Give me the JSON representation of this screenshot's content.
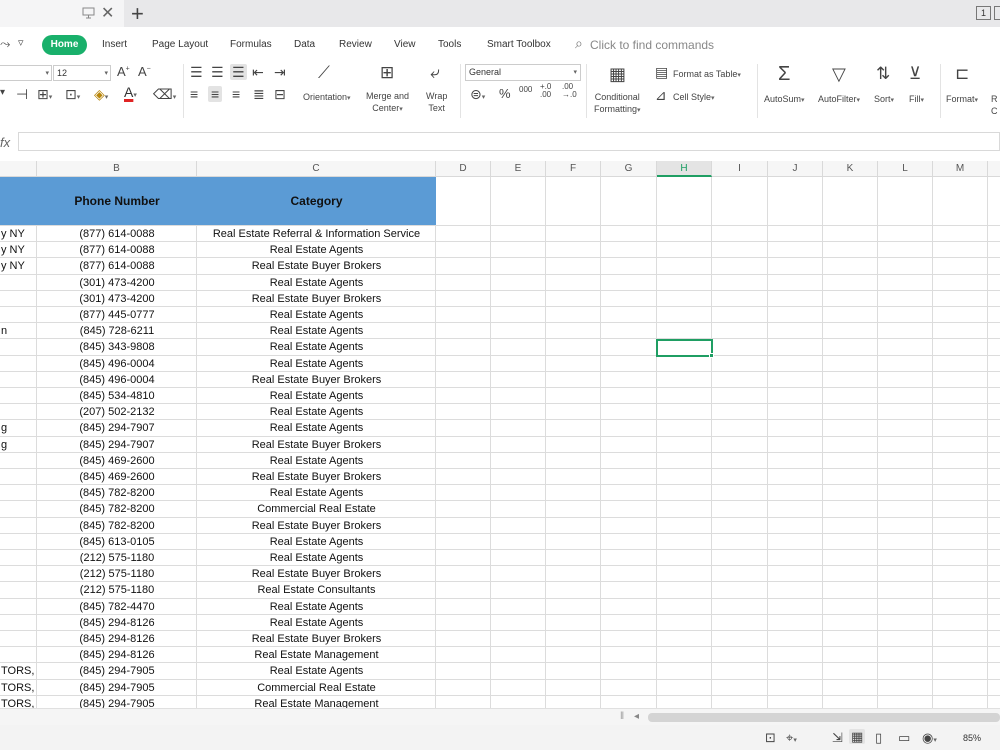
{
  "titlebar": {
    "window_number": "1"
  },
  "menu": {
    "items": [
      "Home",
      "Insert",
      "Page Layout",
      "Formulas",
      "Data",
      "Review",
      "View",
      "Tools",
      "Smart Toolbox"
    ],
    "search_placeholder": "Click to find commands",
    "accent_color": "#19b06b"
  },
  "ribbon": {
    "font_size": "12",
    "number_format": "General",
    "orientation": "Orientation",
    "merge_center": [
      "Merge and",
      "Center"
    ],
    "wrap_text": [
      "Wrap",
      "Text"
    ],
    "conditional_formatting": [
      "Conditional",
      "Formatting"
    ],
    "format_as_table": "Format as Table",
    "cell_style": "Cell Style",
    "autosum": "AutoSum",
    "autofilter": "AutoFilter",
    "sort": "Sort",
    "fill": "Fill",
    "format": "Format",
    "cut_label": "R",
    "cut_label2": "C",
    "percent": "%",
    "thousands": "000",
    "dec_inc": "+.0\n.00",
    "dec_dec": ".00\n→.0"
  },
  "formula_bar": {
    "fx": "fx",
    "value": ""
  },
  "sheet": {
    "columns": [
      "B",
      "C",
      "D",
      "E",
      "F",
      "G",
      "H",
      "I",
      "J",
      "K",
      "L",
      "M"
    ],
    "selected_column": "H",
    "header_fill": "#5b9bd5",
    "headers": {
      "phone": "Phone Number",
      "category": "Category"
    },
    "rows": [
      {
        "a": "y NY",
        "phone": "(877) 614-0088",
        "category": "Real Estate Referral & Information Service"
      },
      {
        "a": "y NY",
        "phone": "(877) 614-0088",
        "category": "Real Estate Agents"
      },
      {
        "a": "y NY",
        "phone": "(877) 614-0088",
        "category": "Real Estate Buyer Brokers"
      },
      {
        "a": "",
        "phone": "(301) 473-4200",
        "category": "Real Estate Agents"
      },
      {
        "a": "",
        "phone": "(301) 473-4200",
        "category": "Real Estate Buyer Brokers"
      },
      {
        "a": "",
        "phone": "(877) 445-0777",
        "category": "Real Estate Agents"
      },
      {
        "a": "n",
        "phone": "(845) 728-6211",
        "category": "Real Estate Agents"
      },
      {
        "a": "",
        "phone": "(845) 343-9808",
        "category": "Real Estate Agents"
      },
      {
        "a": "",
        "phone": "(845) 496-0004",
        "category": "Real Estate Agents"
      },
      {
        "a": "",
        "phone": "(845) 496-0004",
        "category": "Real Estate Buyer Brokers"
      },
      {
        "a": "",
        "phone": "(845) 534-4810",
        "category": "Real Estate Agents"
      },
      {
        "a": "",
        "phone": "(207) 502-2132",
        "category": "Real Estate Agents"
      },
      {
        "a": "g",
        "phone": "(845) 294-7907",
        "category": "Real Estate Agents"
      },
      {
        "a": "g",
        "phone": "(845) 294-7907",
        "category": "Real Estate Buyer Brokers"
      },
      {
        "a": "",
        "phone": "(845) 469-2600",
        "category": "Real Estate Agents"
      },
      {
        "a": "",
        "phone": "(845) 469-2600",
        "category": "Real Estate Buyer Brokers"
      },
      {
        "a": "",
        "phone": "(845) 782-8200",
        "category": "Real Estate Agents"
      },
      {
        "a": "",
        "phone": "(845) 782-8200",
        "category": "Commercial Real Estate"
      },
      {
        "a": "",
        "phone": "(845) 782-8200",
        "category": "Real Estate Buyer Brokers"
      },
      {
        "a": "",
        "phone": "(845) 613-0105",
        "category": "Real Estate Agents"
      },
      {
        "a": "",
        "phone": "(212) 575-1180",
        "category": "Real Estate Agents"
      },
      {
        "a": "",
        "phone": "(212) 575-1180",
        "category": "Real Estate Buyer Brokers"
      },
      {
        "a": "",
        "phone": "(212) 575-1180",
        "category": "Real Estate Consultants"
      },
      {
        "a": "",
        "phone": "(845) 782-4470",
        "category": "Real Estate Agents"
      },
      {
        "a": "",
        "phone": "(845) 294-8126",
        "category": "Real Estate Agents"
      },
      {
        "a": "",
        "phone": "(845) 294-8126",
        "category": "Real Estate Buyer Brokers"
      },
      {
        "a": "",
        "phone": "(845) 294-8126",
        "category": "Real Estate Management"
      },
      {
        "a": "TORS, Ir",
        "phone": "(845) 294-7905",
        "category": "Real Estate Agents"
      },
      {
        "a": "TORS, Ir",
        "phone": "(845) 294-7905",
        "category": "Commercial Real Estate"
      },
      {
        "a": "TORS, Ir",
        "phone": "(845) 294-7905",
        "category": "Real Estate Management"
      }
    ]
  },
  "status_bar": {
    "zoom": "85%"
  }
}
